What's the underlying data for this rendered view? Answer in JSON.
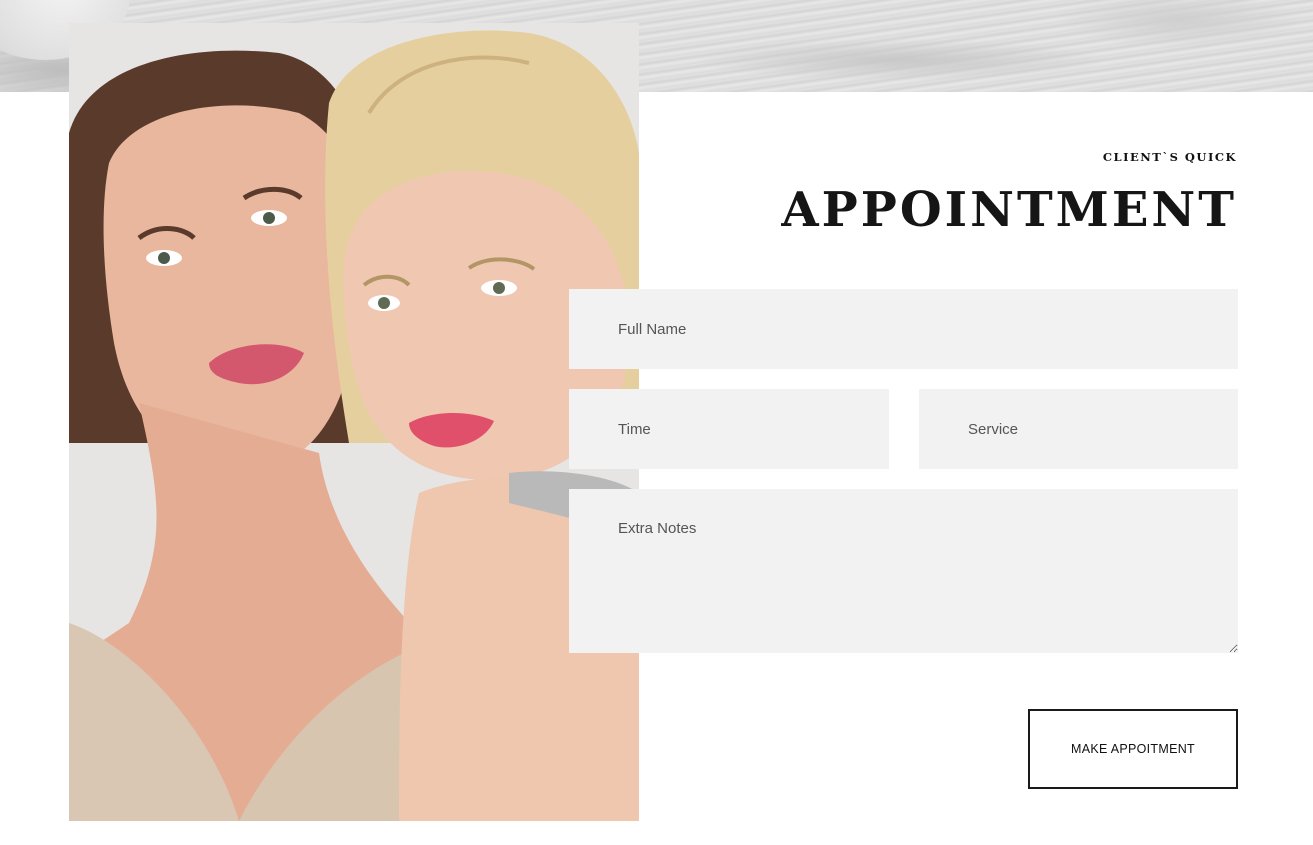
{
  "header": {
    "eyebrow": "CLIENT`S QUICK",
    "title": "APPOINTMENT"
  },
  "form": {
    "full_name_placeholder": "Full Name",
    "time_placeholder": "Time",
    "service_placeholder": "Service",
    "notes_placeholder": "Extra Notes",
    "submit_label": "MAKE APPOITMENT"
  },
  "colors": {
    "field_bg": "#f2f2f2",
    "text": "#151515",
    "button_border": "#1a1a1a"
  }
}
